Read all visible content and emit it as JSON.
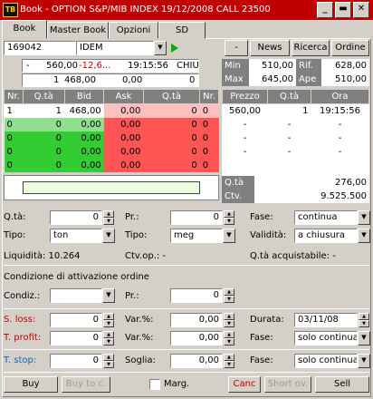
{
  "window": {
    "title": "Book - OPTION S&P/MIB INDEX 19/12/2008 CALL 23500",
    "icon": "TB",
    "min": "_",
    "max": "▬",
    "close": "✕"
  },
  "tabs": [
    {
      "label": "Book"
    },
    {
      "label": "Master Book"
    },
    {
      "label": "Opzioni"
    },
    {
      "label": "SD"
    }
  ],
  "toolbar": {
    "code": "169042",
    "market": "IDEM",
    "minus_label": "-",
    "news_label": "News",
    "search_label": "Ricerca",
    "orders_label": "Ordine"
  },
  "quote": {
    "row1": {
      "c0": "-",
      "c1": "560,00",
      "c2": "-12,6...",
      "c3": "19:15:56",
      "c4": "CHIU"
    },
    "row2": {
      "c0": "1",
      "c1": "468,00",
      "c2": "0,00",
      "c3": "0"
    }
  },
  "stats": {
    "min_label": "Min",
    "min": "510,00",
    "rif_label": "Rif.",
    "rif": "628,00",
    "max_label": "Max",
    "max": "645,00",
    "ape_label": "Ape",
    "ape": "510,00"
  },
  "book": {
    "headers": [
      "Nr.",
      "Q.tà",
      "Bid",
      "Ask",
      "Q.tà",
      "Nr."
    ],
    "rows": [
      [
        "1",
        "1",
        "468,00",
        "0,00",
        "0",
        "0"
      ],
      [
        "0",
        "0",
        "0,00",
        "0,00",
        "0",
        "0"
      ],
      [
        "0",
        "0",
        "0,00",
        "0,00",
        "0",
        "0"
      ],
      [
        "0",
        "0",
        "0,00",
        "0,00",
        "0",
        "0"
      ],
      [
        "0",
        "0",
        "0,00",
        "0,00",
        "0",
        "0"
      ]
    ]
  },
  "trades": {
    "headers": [
      "Prezzo",
      "Q.tà",
      "Ora"
    ],
    "rows": [
      [
        "560,00",
        "1",
        "19:15:56"
      ],
      [
        "-",
        "-",
        "-"
      ],
      [
        "-",
        "-",
        "-"
      ],
      [
        "-",
        "-",
        "-"
      ],
      [
        "-",
        "-",
        "-"
      ]
    ]
  },
  "totals": {
    "qty_label": "Q.tà",
    "qty": "276,00",
    "ctv_label": "Ctv.",
    "ctv": "9.525.500"
  },
  "order": {
    "qty_label": "Q.tà:",
    "qty": "0",
    "pr_label": "Pr.:",
    "pr": "0",
    "fase_label": "Fase:",
    "fase": "continua",
    "tipo_label": "Tipo:",
    "tipo1": "ton",
    "tipo2_label": "Tipo:",
    "tipo2": "meg",
    "validita_label": "Validità:",
    "validita": "a chiusura",
    "liquidita": "Liquidità: 10.264",
    "ctvop": "Ctv.op.: -",
    "qtaacq": "Q.tà acquistabile: -"
  },
  "condition": {
    "title": "Condizione di attivazione ordine",
    "condiz_label": "Condiz.:",
    "condiz": "",
    "pr_label": "Pr.:",
    "pr": "0"
  },
  "stop": {
    "sloss_label": "S. loss:",
    "sloss": "0",
    "var1_label": "Var.%:",
    "var1": "0,00",
    "durata_label": "Durata:",
    "durata": "03/11/08",
    "tprofit_label": "T. profit:",
    "tprofit": "0",
    "var2_label": "Var.%:",
    "var2": "0,00",
    "fase2_label": "Fase:",
    "fase2": "solo continua",
    "tstop_label": "T. stop:",
    "tstop": "0",
    "soglia_label": "Soglia:",
    "soglia": "0,00",
    "fase3_label": "Fase:",
    "fase3": "solo continua"
  },
  "actions": {
    "buy": "Buy",
    "buytoc": "Buy to c.",
    "marg": "Marg.",
    "canc": "Canc",
    "shortov": "Short ov.",
    "sell": "Sell"
  },
  "colors": {
    "title_red": "#c00000",
    "bid_green": "#33cc33",
    "ask_red": "#ff5555",
    "bid_green_light": "#8fdf8f",
    "ask_red_light": "#ffbfbf"
  }
}
